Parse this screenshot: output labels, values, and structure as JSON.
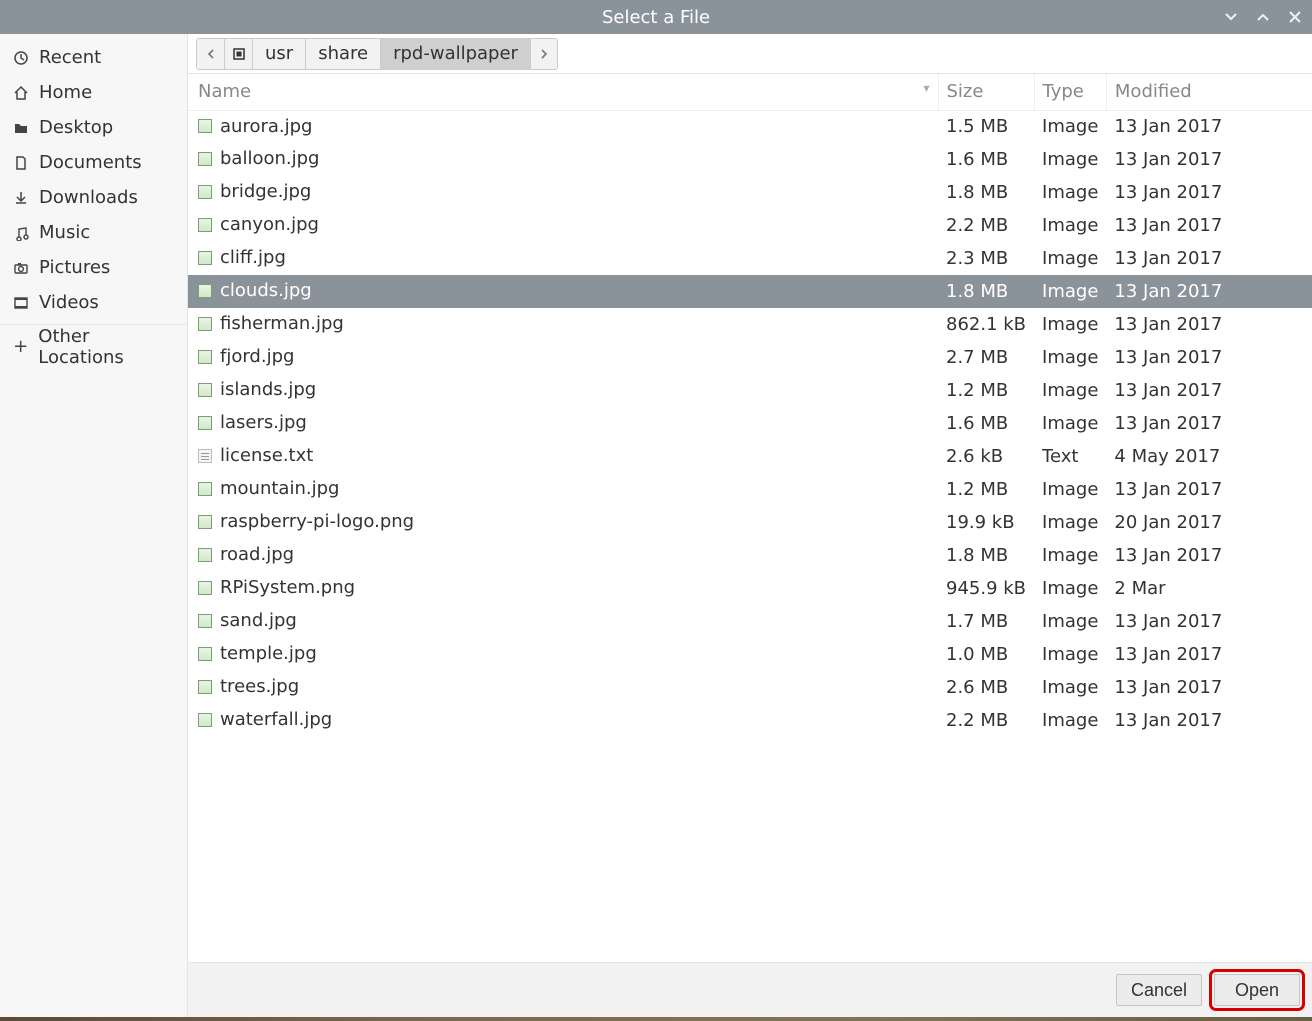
{
  "window_title": "Select a File",
  "sidebar": {
    "items": [
      {
        "label": "Recent",
        "icon": "clock"
      },
      {
        "label": "Home",
        "icon": "home"
      },
      {
        "label": "Desktop",
        "icon": "folder"
      },
      {
        "label": "Documents",
        "icon": "document"
      },
      {
        "label": "Downloads",
        "icon": "download"
      },
      {
        "label": "Music",
        "icon": "music"
      },
      {
        "label": "Pictures",
        "icon": "camera"
      },
      {
        "label": "Videos",
        "icon": "video"
      }
    ],
    "other_locations_label": "Other Locations"
  },
  "breadcrumb": {
    "segments": [
      "usr",
      "share",
      "rpd-wallpaper"
    ],
    "current_index": 2
  },
  "columns": {
    "name": "Name",
    "size": "Size",
    "type": "Type",
    "modified": "Modified"
  },
  "sort_indicator": "▾",
  "files": [
    {
      "name": "aurora.jpg",
      "size": "1.5 MB",
      "type": "Image",
      "modified": "13 Jan 2017",
      "icon": "image"
    },
    {
      "name": "balloon.jpg",
      "size": "1.6 MB",
      "type": "Image",
      "modified": "13 Jan 2017",
      "icon": "image"
    },
    {
      "name": "bridge.jpg",
      "size": "1.8 MB",
      "type": "Image",
      "modified": "13 Jan 2017",
      "icon": "image"
    },
    {
      "name": "canyon.jpg",
      "size": "2.2 MB",
      "type": "Image",
      "modified": "13 Jan 2017",
      "icon": "image"
    },
    {
      "name": "cliff.jpg",
      "size": "2.3 MB",
      "type": "Image",
      "modified": "13 Jan 2017",
      "icon": "image"
    },
    {
      "name": "clouds.jpg",
      "size": "1.8 MB",
      "type": "Image",
      "modified": "13 Jan 2017",
      "icon": "image",
      "selected": true
    },
    {
      "name": "fisherman.jpg",
      "size": "862.1 kB",
      "type": "Image",
      "modified": "13 Jan 2017",
      "icon": "image"
    },
    {
      "name": "fjord.jpg",
      "size": "2.7 MB",
      "type": "Image",
      "modified": "13 Jan 2017",
      "icon": "image"
    },
    {
      "name": "islands.jpg",
      "size": "1.2 MB",
      "type": "Image",
      "modified": "13 Jan 2017",
      "icon": "image"
    },
    {
      "name": "lasers.jpg",
      "size": "1.6 MB",
      "type": "Image",
      "modified": "13 Jan 2017",
      "icon": "image"
    },
    {
      "name": "license.txt",
      "size": "2.6 kB",
      "type": "Text",
      "modified": "4 May 2017",
      "icon": "text"
    },
    {
      "name": "mountain.jpg",
      "size": "1.2 MB",
      "type": "Image",
      "modified": "13 Jan 2017",
      "icon": "image"
    },
    {
      "name": "raspberry-pi-logo.png",
      "size": "19.9 kB",
      "type": "Image",
      "modified": "20 Jan 2017",
      "icon": "image"
    },
    {
      "name": "road.jpg",
      "size": "1.8 MB",
      "type": "Image",
      "modified": "13 Jan 2017",
      "icon": "image"
    },
    {
      "name": "RPiSystem.png",
      "size": "945.9 kB",
      "type": "Image",
      "modified": "2 Mar",
      "icon": "image"
    },
    {
      "name": "sand.jpg",
      "size": "1.7 MB",
      "type": "Image",
      "modified": "13 Jan 2017",
      "icon": "image"
    },
    {
      "name": "temple.jpg",
      "size": "1.0 MB",
      "type": "Image",
      "modified": "13 Jan 2017",
      "icon": "image"
    },
    {
      "name": "trees.jpg",
      "size": "2.6 MB",
      "type": "Image",
      "modified": "13 Jan 2017",
      "icon": "image"
    },
    {
      "name": "waterfall.jpg",
      "size": "2.2 MB",
      "type": "Image",
      "modified": "13 Jan 2017",
      "icon": "image"
    }
  ],
  "buttons": {
    "cancel": "Cancel",
    "open": "Open"
  }
}
